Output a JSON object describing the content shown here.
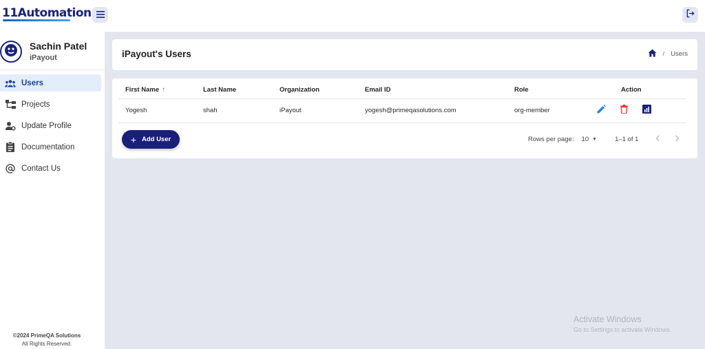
{
  "app": {
    "logo_text": "11Automation"
  },
  "user": {
    "name": "Sachin Patel",
    "org": "iPayout"
  },
  "sidebar": {
    "items": [
      {
        "label": "Users",
        "icon": "users-icon"
      },
      {
        "label": "Projects",
        "icon": "projects-icon"
      },
      {
        "label": "Update Profile",
        "icon": "update-profile-icon"
      },
      {
        "label": "Documentation",
        "icon": "documentation-icon"
      },
      {
        "label": "Contact Us",
        "icon": "at-sign-icon"
      }
    ],
    "footer_line1": "©2024 PrimeQA Solutions",
    "footer_line2": "All Rights Reserved."
  },
  "page": {
    "title": "iPayout's Users",
    "breadcrumb_sep": "/",
    "breadcrumb_current": "Users"
  },
  "table": {
    "headers": {
      "first_name": "First Name",
      "last_name": "Last Name",
      "organization": "Organization",
      "email": "Email ID",
      "role": "Role",
      "action": "Action"
    },
    "sort_indicator": "↑",
    "rows": [
      {
        "first_name": "Yogesh",
        "last_name": "shah",
        "organization": "iPayout",
        "email": "yogesh@primeqasolutions.com",
        "role": "org-member"
      }
    ]
  },
  "actions": {
    "add_user_label": "Add User",
    "add_user_plus": "+"
  },
  "pagination": {
    "rows_per_page_label": "Rows per page:",
    "rows_per_page_value": "10",
    "range": "1–1 of 1"
  },
  "watermark": {
    "line1": "Activate Windows",
    "line2": "Go to Settings to activate Windows."
  },
  "colors": {
    "brand": "#1a1f7a",
    "active_nav_bg": "#e3eefb",
    "edit_icon": "#1e88e5",
    "delete_icon": "#e53935",
    "report_icon": "#1a237e"
  }
}
